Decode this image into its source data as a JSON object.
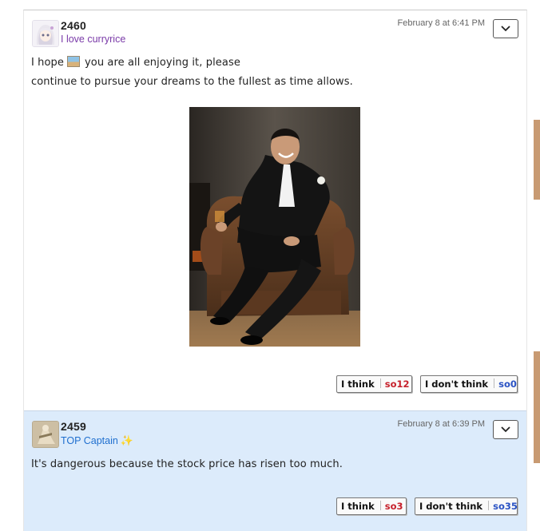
{
  "posts": [
    {
      "number": "2460",
      "user": "I love curryrice",
      "timestamp": "February 8 at 6:41 PM",
      "text_line1_before": "I hope",
      "text_line1_after": "you are all enjoying it, please",
      "text_line2": "continue to pursue your dreams to the fullest as time allows.",
      "votes": {
        "think_label": "I think",
        "think_count": "so12",
        "dont_label": "I don't think",
        "dont_count": "so0"
      }
    },
    {
      "number": "2459",
      "user": "TOP Captain",
      "timestamp": "February 8 at 6:39 PM",
      "text": "It's dangerous because the stock price has risen too much.",
      "votes": {
        "think_label": "I think",
        "think_count": "so3",
        "dont_label": "I don't think",
        "dont_count": "so35"
      }
    }
  ],
  "colors": {
    "post_highlight_bg": "#dcebfb",
    "user_name_1": "#7a3aa8",
    "user_name_2": "#1f6fcf",
    "think_count": "#c6202b",
    "dont_count": "#2b53c4"
  },
  "icons": {
    "menu": "chevron-down-icon",
    "badge": "sparkle-icon"
  }
}
